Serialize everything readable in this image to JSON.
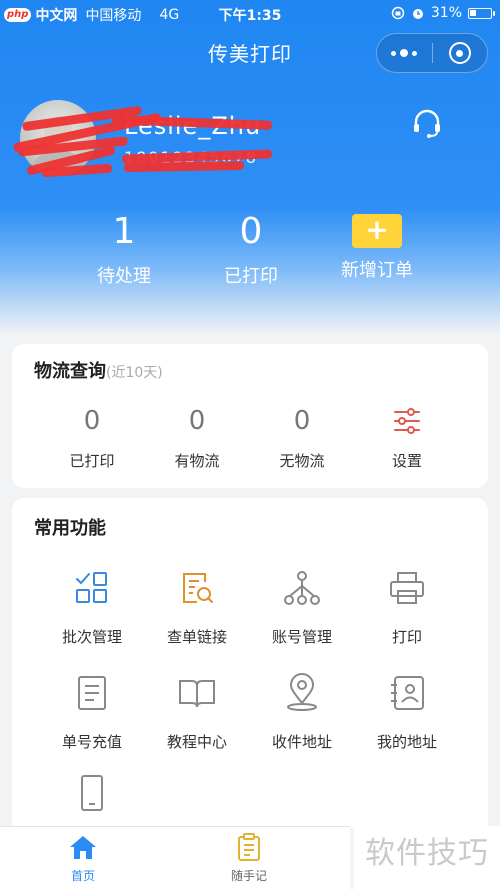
{
  "status_bar": {
    "logo": "php",
    "logo_text": "中文网",
    "carrier": "中国移动",
    "network": "4G",
    "time": "下午1:35",
    "battery": "31%",
    "battery_level": 0.31
  },
  "nav": {
    "title": "传美打印"
  },
  "user": {
    "name": "Leslie_Zhu",
    "id": "18912345678"
  },
  "stats": [
    {
      "value": "1",
      "label": "待处理"
    },
    {
      "value": "0",
      "label": "已打印"
    },
    {
      "value": "+",
      "label": "新增订单"
    }
  ],
  "logistics": {
    "title": "物流查询",
    "subtitle": "(近10天)",
    "items": [
      {
        "value": "0",
        "label": "已打印"
      },
      {
        "value": "0",
        "label": "有物流"
      },
      {
        "value": "0",
        "label": "无物流"
      },
      {
        "label": "设置"
      }
    ]
  },
  "functions": {
    "title": "常用功能",
    "items": [
      {
        "label": "批次管理",
        "icon": "batch-icon"
      },
      {
        "label": "查单链接",
        "icon": "order-search-icon"
      },
      {
        "label": "账号管理",
        "icon": "account-tree-icon"
      },
      {
        "label": "打印",
        "icon": "printer-icon"
      },
      {
        "label": "单号充值",
        "icon": "recharge-icon"
      },
      {
        "label": "教程中心",
        "icon": "book-icon"
      },
      {
        "label": "收件地址",
        "icon": "location-icon"
      },
      {
        "label": "我的地址",
        "icon": "contact-card-icon"
      },
      {
        "label": "",
        "icon": "phone-icon"
      }
    ]
  },
  "tabbar": {
    "items": [
      {
        "label": "首页",
        "active": true
      },
      {
        "label": "随手记",
        "active": false
      }
    ]
  },
  "watermark": "软件技巧",
  "colors": {
    "primary": "#2b8bf4",
    "accent_yellow": "#ffd43b",
    "icon_blue": "#3a87e0",
    "icon_orange": "#e0912e",
    "icon_red": "#e05a4f",
    "icon_gray": "#888888"
  }
}
